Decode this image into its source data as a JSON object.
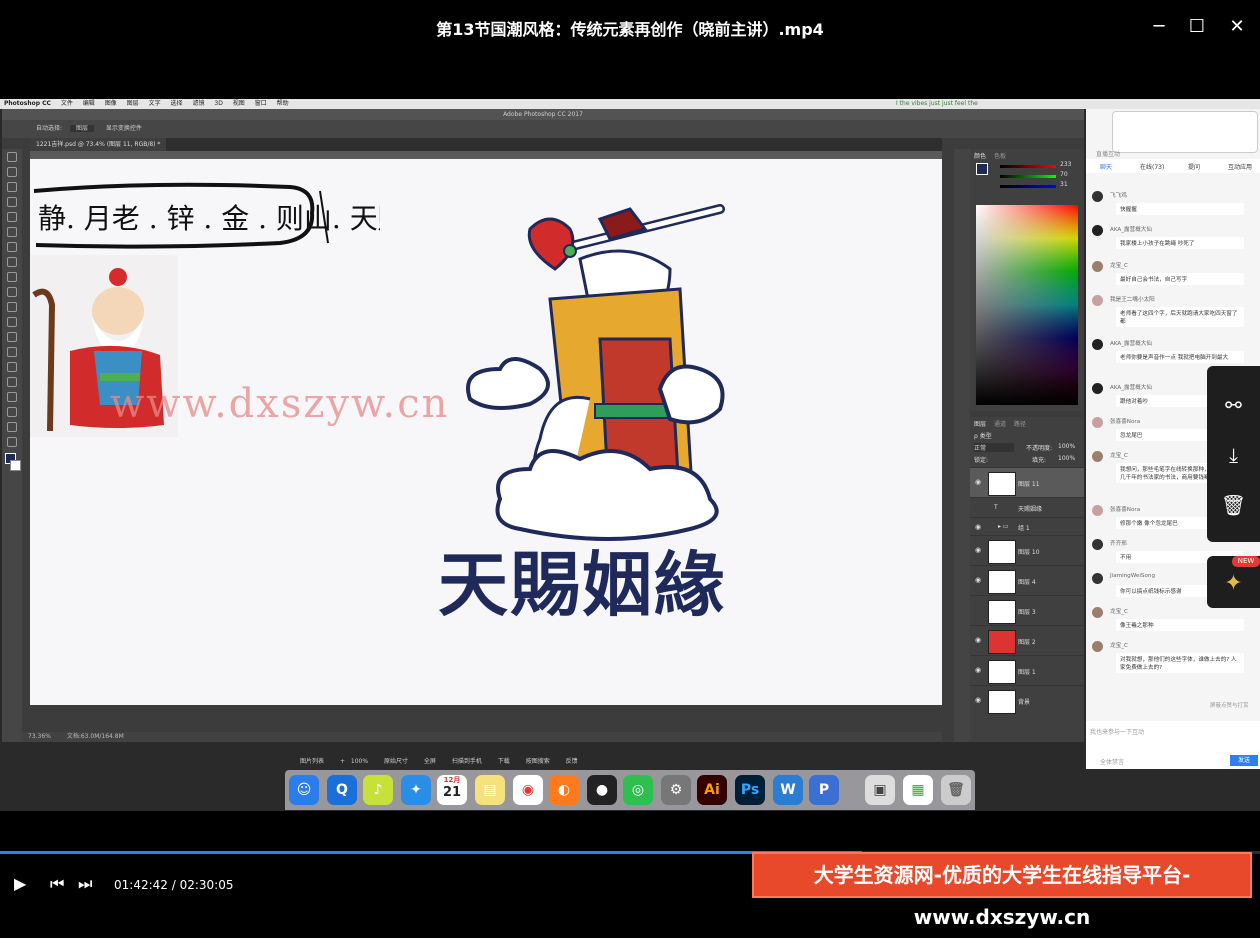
{
  "window": {
    "title": "第13节国潮风格：传统元素再创作（晓前主讲）.mp4",
    "minimize": "─",
    "maximize": "☐",
    "close": "✕"
  },
  "mac_menubar": {
    "items": [
      "Photoshop CC",
      "文件",
      "编辑",
      "图像",
      "图层",
      "文字",
      "选择",
      "滤镜",
      "3D",
      "视图",
      "窗口",
      "帮助"
    ],
    "marquee": "I the vibes just just feel the"
  },
  "photoshop": {
    "app_title": "Adobe Photoshop CC 2017",
    "options": {
      "auto_select": "自动选择:",
      "layer_option": "图层",
      "show_transform": "显示变换控件"
    },
    "doc_tab": "1221吉祥.psd @ 73.4% (图层 11, RGB/8) *",
    "status": {
      "zoom": "73.36%",
      "doc": "文档:63.0M/164.8M"
    },
    "canvas": {
      "sketch_text": "静. 月老 . 锌 . 金 . 则山. 天赐",
      "logo_text": "天賜姻緣"
    },
    "color_panel": {
      "tabs": [
        "颜色",
        "色板"
      ],
      "r": "233",
      "g": "70",
      "b": "31"
    },
    "layers_panel": {
      "tabs": [
        "图层",
        "通道",
        "路径"
      ],
      "kind": "ρ 类型",
      "blend": "正常",
      "opacity_label": "不透明度:",
      "opacity": "100%",
      "lock_label": "锁定:",
      "fill_label": "填充:",
      "fill": "100%",
      "layers": [
        "图层 11",
        "天赐姻缘",
        "组 1",
        "图层 10",
        "图层 4",
        "图层 3",
        "图层 2",
        "图层 1",
        "背景"
      ]
    }
  },
  "watermark": "www.dxszyw.cn",
  "chat": {
    "header": "直播互动",
    "tabs": [
      "聊天",
      "在线(73)",
      "提问",
      "互动应用"
    ],
    "messages": [
      {
        "name": "飞飞鸡",
        "text": "快握握"
      },
      {
        "name": "AKA_露营概大仙",
        "text": "我家楼上小孩子在跳绳 吵死了"
      },
      {
        "name": "龙宝_C",
        "text": "最好自己会书法，自己写字"
      },
      {
        "name": "我是王二嘴小太阳",
        "text": "老师看了这四个字，后天就跑请大家吃四天窗了都"
      },
      {
        "name": "AKA_露营概大仙",
        "text": "老师你要是声音作一点 我就把电脑开到最大"
      },
      {
        "name": "AKA_露营概大仙",
        "text": "跟他对着吵"
      },
      {
        "name": "张喜喜Nora",
        "text": "忽龙尾巴"
      },
      {
        "name": "龙宝_C",
        "text": "我想问，那些毛笔字在线转换那种，过去了几百几千年的书法家的书法，商用要钱嘛"
      },
      {
        "name": "张喜喜Nora",
        "text": "修那个嫩 像个忽龙尾巴"
      },
      {
        "name": "齐齐邢",
        "text": "不用"
      },
      {
        "name": "JiamingWeiSong",
        "text": "你可以搞点纸钱标示感谢"
      },
      {
        "name": "龙宝_C",
        "text": "像王羲之那种"
      },
      {
        "name": "龙宝_C",
        "text": "对我就想，那他们的这些字体，谁做上去的? 人家免费做上去的?"
      }
    ],
    "input_placeholder": "我也来参与一下互动",
    "mute_label": "全体禁言",
    "send": "发送",
    "gift_label": "屏蔽点赞与打赏"
  },
  "side_tools": {
    "share": "share-icon",
    "download": "download-icon",
    "delete": "trash-icon",
    "new_badge": "NEW"
  },
  "dock": {
    "calendar_month": "12月",
    "calendar_day": "21",
    "ai": "Ai",
    "ps": "Ps",
    "word": "W",
    "p": "P"
  },
  "desktop": {
    "bottom_bar": [
      "图片列表",
      "+ 100%",
      "原始尺寸",
      "全屏",
      "扫描到手机",
      "下载",
      "按图搜索",
      "反馈"
    ]
  },
  "player": {
    "time": "01:42:42 / 02:30:05",
    "progress": 0.684,
    "banner": "大学生资源网-优质的大学生在线指导平台-www.dxszyw.cn"
  }
}
